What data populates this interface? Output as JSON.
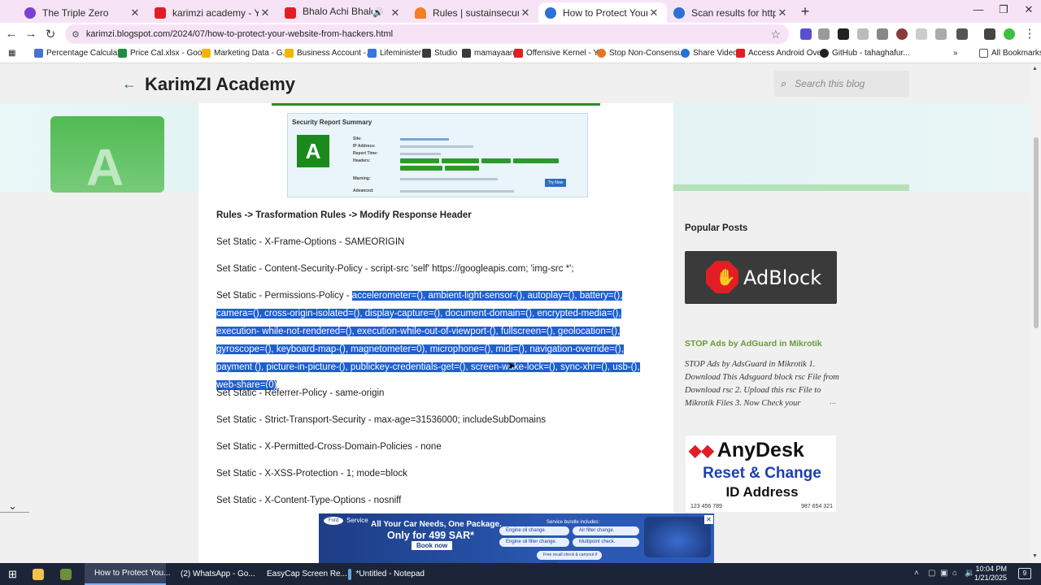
{
  "tabs": [
    {
      "label": "The Triple Zero",
      "color": "#7b3fd0"
    },
    {
      "label": "karimzi academy - YouTube",
      "color": "#e21d24"
    },
    {
      "label": "Bhalo Achi Bhalo Theko | ত",
      "color": "#e21d24"
    },
    {
      "label": "Rules | sustainsecure.com | Ma",
      "color": "#f38020"
    },
    {
      "label": "How to Protect Your Website fr",
      "color": "#2f6fd6"
    },
    {
      "label": "Scan results for https://holisticl",
      "color": "#2f6fd6"
    }
  ],
  "toolbar": {
    "url": "karimzi.blogspot.com/2024/07/how-to-protect-your-website-from-hackers.html"
  },
  "bookmarks": [
    {
      "label": "Percentage Calculat...",
      "color": "#4a6fd6"
    },
    {
      "label": "Price Cal.xlsx - Goo...",
      "color": "#1e8e3e"
    },
    {
      "label": "Marketing Data - G...",
      "color": "#f4b400"
    },
    {
      "label": "Business Account -...",
      "color": "#f4b400"
    },
    {
      "label": "Lifeminister",
      "color": "#3a76d8"
    },
    {
      "label": "Studio",
      "color": "#3a3a3a"
    },
    {
      "label": "mamayaan",
      "color": "#3a3a3a"
    },
    {
      "label": "Offensive Kernel - Y...",
      "color": "#e21d24"
    },
    {
      "label": "Stop Non-Consensu...",
      "color": "#e8741e"
    },
    {
      "label": "Share Video",
      "color": "#2a6fd6"
    },
    {
      "label": "Access Android Ove...",
      "color": "#e21d24"
    },
    {
      "label": "GitHub - tahaghafur...",
      "color": "#222222"
    }
  ],
  "all_bookmarks": "All Bookmarks",
  "blog": {
    "title": "KarimZI Academy",
    "search_placeholder": "Search this blog"
  },
  "report": {
    "title": "Security Report Summary",
    "grade": "A",
    "rows": [
      "Site:",
      "IP Address:",
      "Report Time:",
      "Headers:",
      "",
      "Warning:",
      "Advanced:"
    ],
    "button": "Try Now"
  },
  "content": {
    "heading": "Rules -> Trasformation Rules -> Modify Response Header",
    "frame": "Set Static - X-Frame-Options - SAMEORIGIN",
    "csp": "Set Static - Content-Security-Policy - script-src 'self' https://googleapis.com; 'img-src *';",
    "perm_prefix": "Set Static - Permissions-Policy - ",
    "perm_selected": "accelerometer=(), ambient-light-sensor-(), autoplay=(), battery=(), camera=(), cross-origin-isolated=(), display-capture=(), document-domain=(), encrypted-media=(), execution- while-not-rendered=(), execution-while-out-of-viewport-(), fullscreen=(), geolocation=(), gyroscope=(), keyboard-map-(), magnetometer=0), microphone=(), midi=(), navigation-override=(), payment (), picture-in-picture-(), publickey-credentials-get=(), screen-wake-lock=(), sync-xhr=(), usb-(), web-share=(0)",
    "referrer": "Set Static - Referrer-Policy - same-origin",
    "hsts": "Set Static - Strict-Transport-Security - max-age=31536000; includeSubDomains",
    "xpcdp": "Set Static - X-Permitted-Cross-Domain-Policies - none",
    "xss": "Set Static - X-XSS-Protection - 1; mode=block",
    "xcto": "Set Static - X-Content-Type-Options - nosniff"
  },
  "sidebar": {
    "heading": "Popular Posts",
    "adblock_text": "AdBlock",
    "post_title": "STOP Ads by AdGuard in Mikrotik",
    "post_snippet": "STOP Ads by AdsGuard in Mikrotik 1. Download This Adsguard block rsc File from Download rsc 2. Upload this rsc File to Mikrotik Files 3. Now Check your",
    "more": "...",
    "anydesk": {
      "line1": "AnyDesk",
      "line2": "Reset & Change",
      "line3": "ID Address",
      "id_left": "123 456 789",
      "id_right": "987 654 321"
    }
  },
  "ad": {
    "service": "Service",
    "line1": "All Your Car Needs, One Package.",
    "line2": "Only for 499 SAR*",
    "book": "Book now",
    "includes": "Service bundle includes:",
    "items": [
      "Engine oil change.",
      "Air filter change.",
      "Engine oil filter change.",
      "Multipoint check.",
      "Free recall check & carryout if needed."
    ]
  },
  "taskbar": {
    "items": [
      {
        "label": "How to Protect You...",
        "color": "#2f6fd6"
      },
      {
        "label": "(2) WhatsApp - Go...",
        "color": "#25d366"
      },
      {
        "label": "EasyCap Screen Re...",
        "color": "#2a8ad8"
      },
      {
        "label": "*Untitled - Notepad",
        "color": "#6aa7e0"
      }
    ],
    "time": "10:04 PM",
    "date": "1/21/2025",
    "notifications": "9"
  }
}
